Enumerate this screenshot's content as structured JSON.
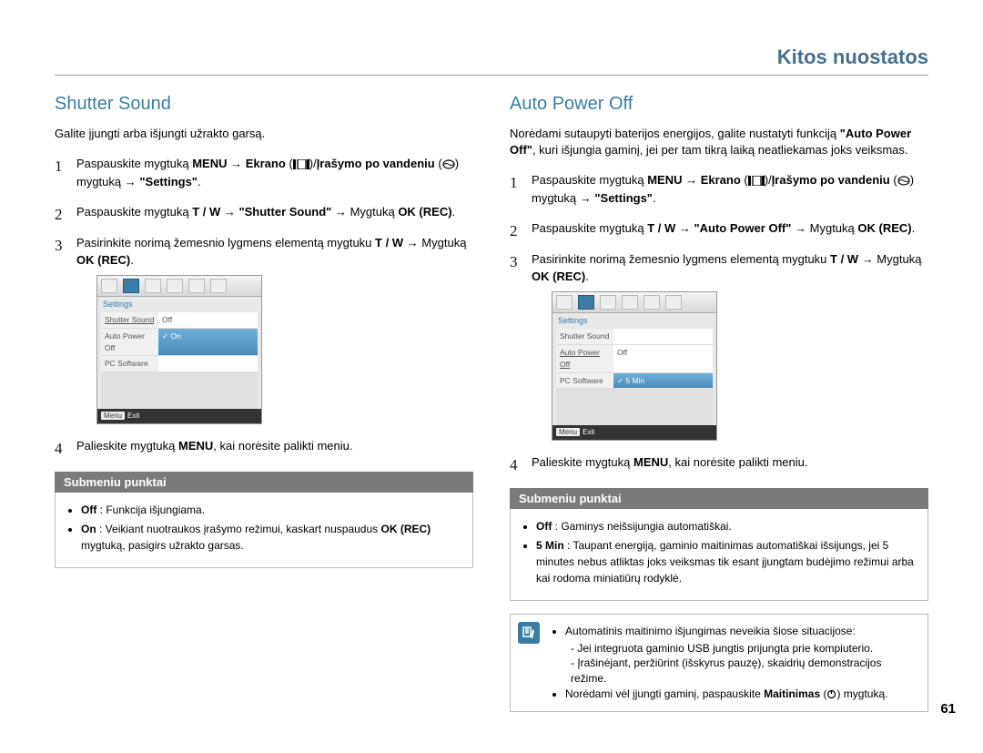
{
  "page_header": "Kitos nuostatos",
  "page_number": "61",
  "left": {
    "title": "Shutter Sound",
    "intro": "Galite įjungti arba išjungti užrakto garsą.",
    "step1_a": "Paspauskite mygtuką ",
    "step1_menu": "MENU",
    "step1_b": " → ",
    "step1_ekrano": "Ekrano",
    "step1_c": " (",
    "step1_d": ")/",
    "step1_irasymo": "Įrašymo po vandeniu",
    "step1_e": " (",
    "step1_f": ") mygtuką → ",
    "step1_settings": "\"Settings\"",
    "step1_g": ".",
    "step2_a": "Paspauskite mygtuką ",
    "step2_tw": "T / W",
    "step2_b": " → ",
    "step2_shutter": "\"Shutter Sound\"",
    "step2_c": " → Mygtuką ",
    "step2_ok": "OK (REC)",
    "step2_d": ".",
    "step3_a": "Pasirinkite norimą žemesnio lygmens elementą mygtuku ",
    "step3_tw": "T / W",
    "step3_b": " → Mygtuką ",
    "step3_ok": "OK (REC)",
    "step3_c": ".",
    "step4_a": "Palieskite mygtuką ",
    "step4_menu": "MENU",
    "step4_b": ", kai norėsite palikti meniu.",
    "menu": {
      "settings": "Settings",
      "row1_l": "Shutter Sound",
      "row1_r": "Off",
      "row2_l": "Auto Power Off",
      "row2_r": "On",
      "row3_l": "PC Software",
      "exit_btn": "Menu",
      "exit": "Exit"
    },
    "sub_header": "Submeniu punktai",
    "sub_off_b": "Off",
    "sub_off_t": " : Funkcija išjungiama.",
    "sub_on_b": "On",
    "sub_on_t1": " : Veikiant nuotraukos įrašymo režimui, kaskart nuspaudus ",
    "sub_on_ok": "OK (REC)",
    "sub_on_t2": " mygtuką, pasigirs užrakto garsas."
  },
  "right": {
    "title": "Auto Power Off",
    "intro_a": "Norėdami sutaupyti baterijos energijos, galite nustatyti funkciją ",
    "intro_b": "\"Auto Power Off\"",
    "intro_c": ", kuri išjungia gaminį, jei per tam tikrą laiką neatliekamas joks veiksmas.",
    "step2_a": "Paspauskite mygtuką ",
    "step2_tw": "T / W",
    "step2_b": " → ",
    "step2_apo": "\"Auto Power Off\"",
    "step2_c": " → Mygtuką ",
    "step2_ok": "OK (REC)",
    "step2_d": ".",
    "menu": {
      "settings": "Settings",
      "row1_l": "Shutter Sound",
      "row2_l": "Auto Power Off",
      "row2_r_off": "Off",
      "row3_l": "PC Software",
      "row3_r": "5 Min",
      "exit_btn": "Menu",
      "exit": "Exit"
    },
    "sub_header": "Submeniu punktai",
    "sub_off_b": "Off",
    "sub_off_t": " : Gaminys neišsijungia automatiškai.",
    "sub_5_b": "5 Min",
    "sub_5_t": " : Taupant energiją, gaminio maitinimas automatiškai išsijungs, jei 5 minutes nebus atliktas joks veiksmas tik esant įjungtam budėjimo režimui arba kai rodoma miniatiūrų rodyklė.",
    "note1": "Automatinis maitinimo išjungimas neveikia šiose situacijose:",
    "note1a": "Jei integruota gaminio USB jungtis prijungta prie kompiuterio.",
    "note1b": "Įrašinėjant, peržiūrint (išskyrus pauzę), skaidrių demonstracijos režime.",
    "note2_a": "Norėdami vėl įjungti gaminį, paspauskite ",
    "note2_b": "Maitinimas",
    "note2_c": " (",
    "note2_d": ") mygtuką."
  }
}
